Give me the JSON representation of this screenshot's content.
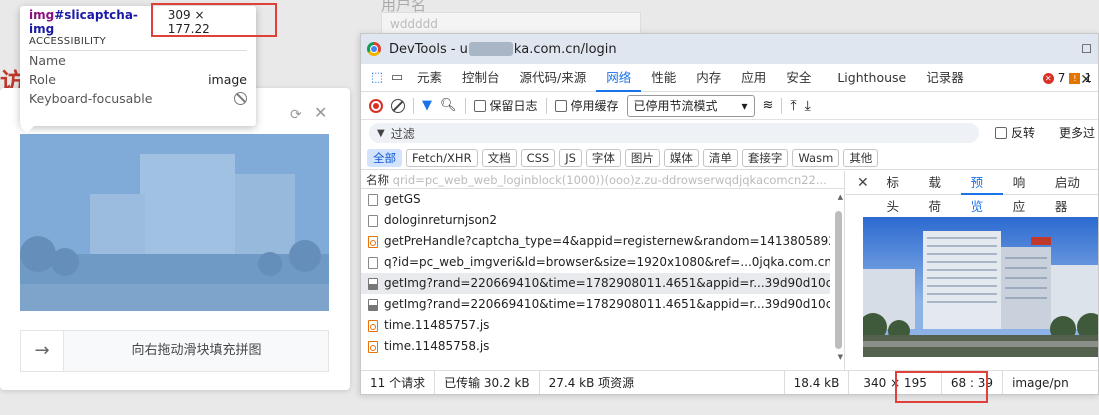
{
  "background": {
    "field_label": "用户名",
    "field_value": "wddddd",
    "red_glyph": "访"
  },
  "captcha": {
    "slider_text": "向右拖动滑块填充拼图",
    "slider_arrow": "→",
    "refresh_icon": "refresh-icon",
    "close_icon": "close-icon"
  },
  "tooltip": {
    "tag": "img",
    "id": "#slicaptcha-img",
    "dimensions": "309 × 177.22",
    "section": "ACCESSIBILITY",
    "rows": [
      {
        "label": "Name",
        "value": ""
      },
      {
        "label": "Role",
        "value": "image"
      },
      {
        "label": "Keyboard-focusable",
        "value": ""
      }
    ]
  },
  "devtools": {
    "title_prefix": "DevTools - u",
    "title_suffix": "ka.com.cn/login",
    "tabs": [
      "元素",
      "控制台",
      "源代码/来源",
      "网络",
      "性能",
      "内存",
      "应用",
      "安全",
      "Lighthouse",
      "记录器"
    ],
    "active_tab": "网络",
    "error_count": "7",
    "warning_count": "1",
    "toolbar": {
      "preserve_log": "保留日志",
      "disable_cache": "停用缓存",
      "throttle": "已停用节流模式"
    },
    "filter": {
      "label": "过滤",
      "invert": "反转",
      "more": "更多过"
    },
    "chips": [
      "全部",
      "Fetch/XHR",
      "文档",
      "CSS",
      "JS",
      "字体",
      "图片",
      "媒体",
      "清单",
      "套接字",
      "Wasm",
      "其他"
    ],
    "net_header": "名称",
    "net_header_ghost": "qrid=pc_web_web_loginblock(1000))(ooo)z.zu-ddrowserwqdjqkacomcn22...",
    "requests": [
      {
        "name": "getGS",
        "type": "doc"
      },
      {
        "name": "dologinreturnjson2",
        "type": "doc"
      },
      {
        "name": "getPreHandle?captcha_type=4&appid=registernew&random=1413805892...",
        "type": "js"
      },
      {
        "name": "q?id=pc_web_imgveri&ld=browser&size=1920x1080&ref=...0jqka.com.cn...",
        "type": "doc"
      },
      {
        "name": "getImg?rand=220669410&time=1782908011.4651&appid=r...39d90d10c0...",
        "type": "img",
        "selected": true
      },
      {
        "name": "getImg?rand=220669410&time=1782908011.4651&appid=r...39d90d10c0...",
        "type": "img"
      },
      {
        "name": "time.11485757.js",
        "type": "js"
      },
      {
        "name": "time.11485758.js",
        "type": "js"
      }
    ],
    "detail_tabs": [
      "标头",
      "载荷",
      "预览",
      "响应",
      "启动器"
    ],
    "active_detail_tab": "预览",
    "status": {
      "requests": "11 个请求",
      "transferred": "已传输 30.2 kB",
      "resources": "27.4 kB 项资源",
      "size": "18.4 kB",
      "dimensions": "340 × 195",
      "ratio": "68 : 39",
      "mime": "image/pn"
    }
  }
}
